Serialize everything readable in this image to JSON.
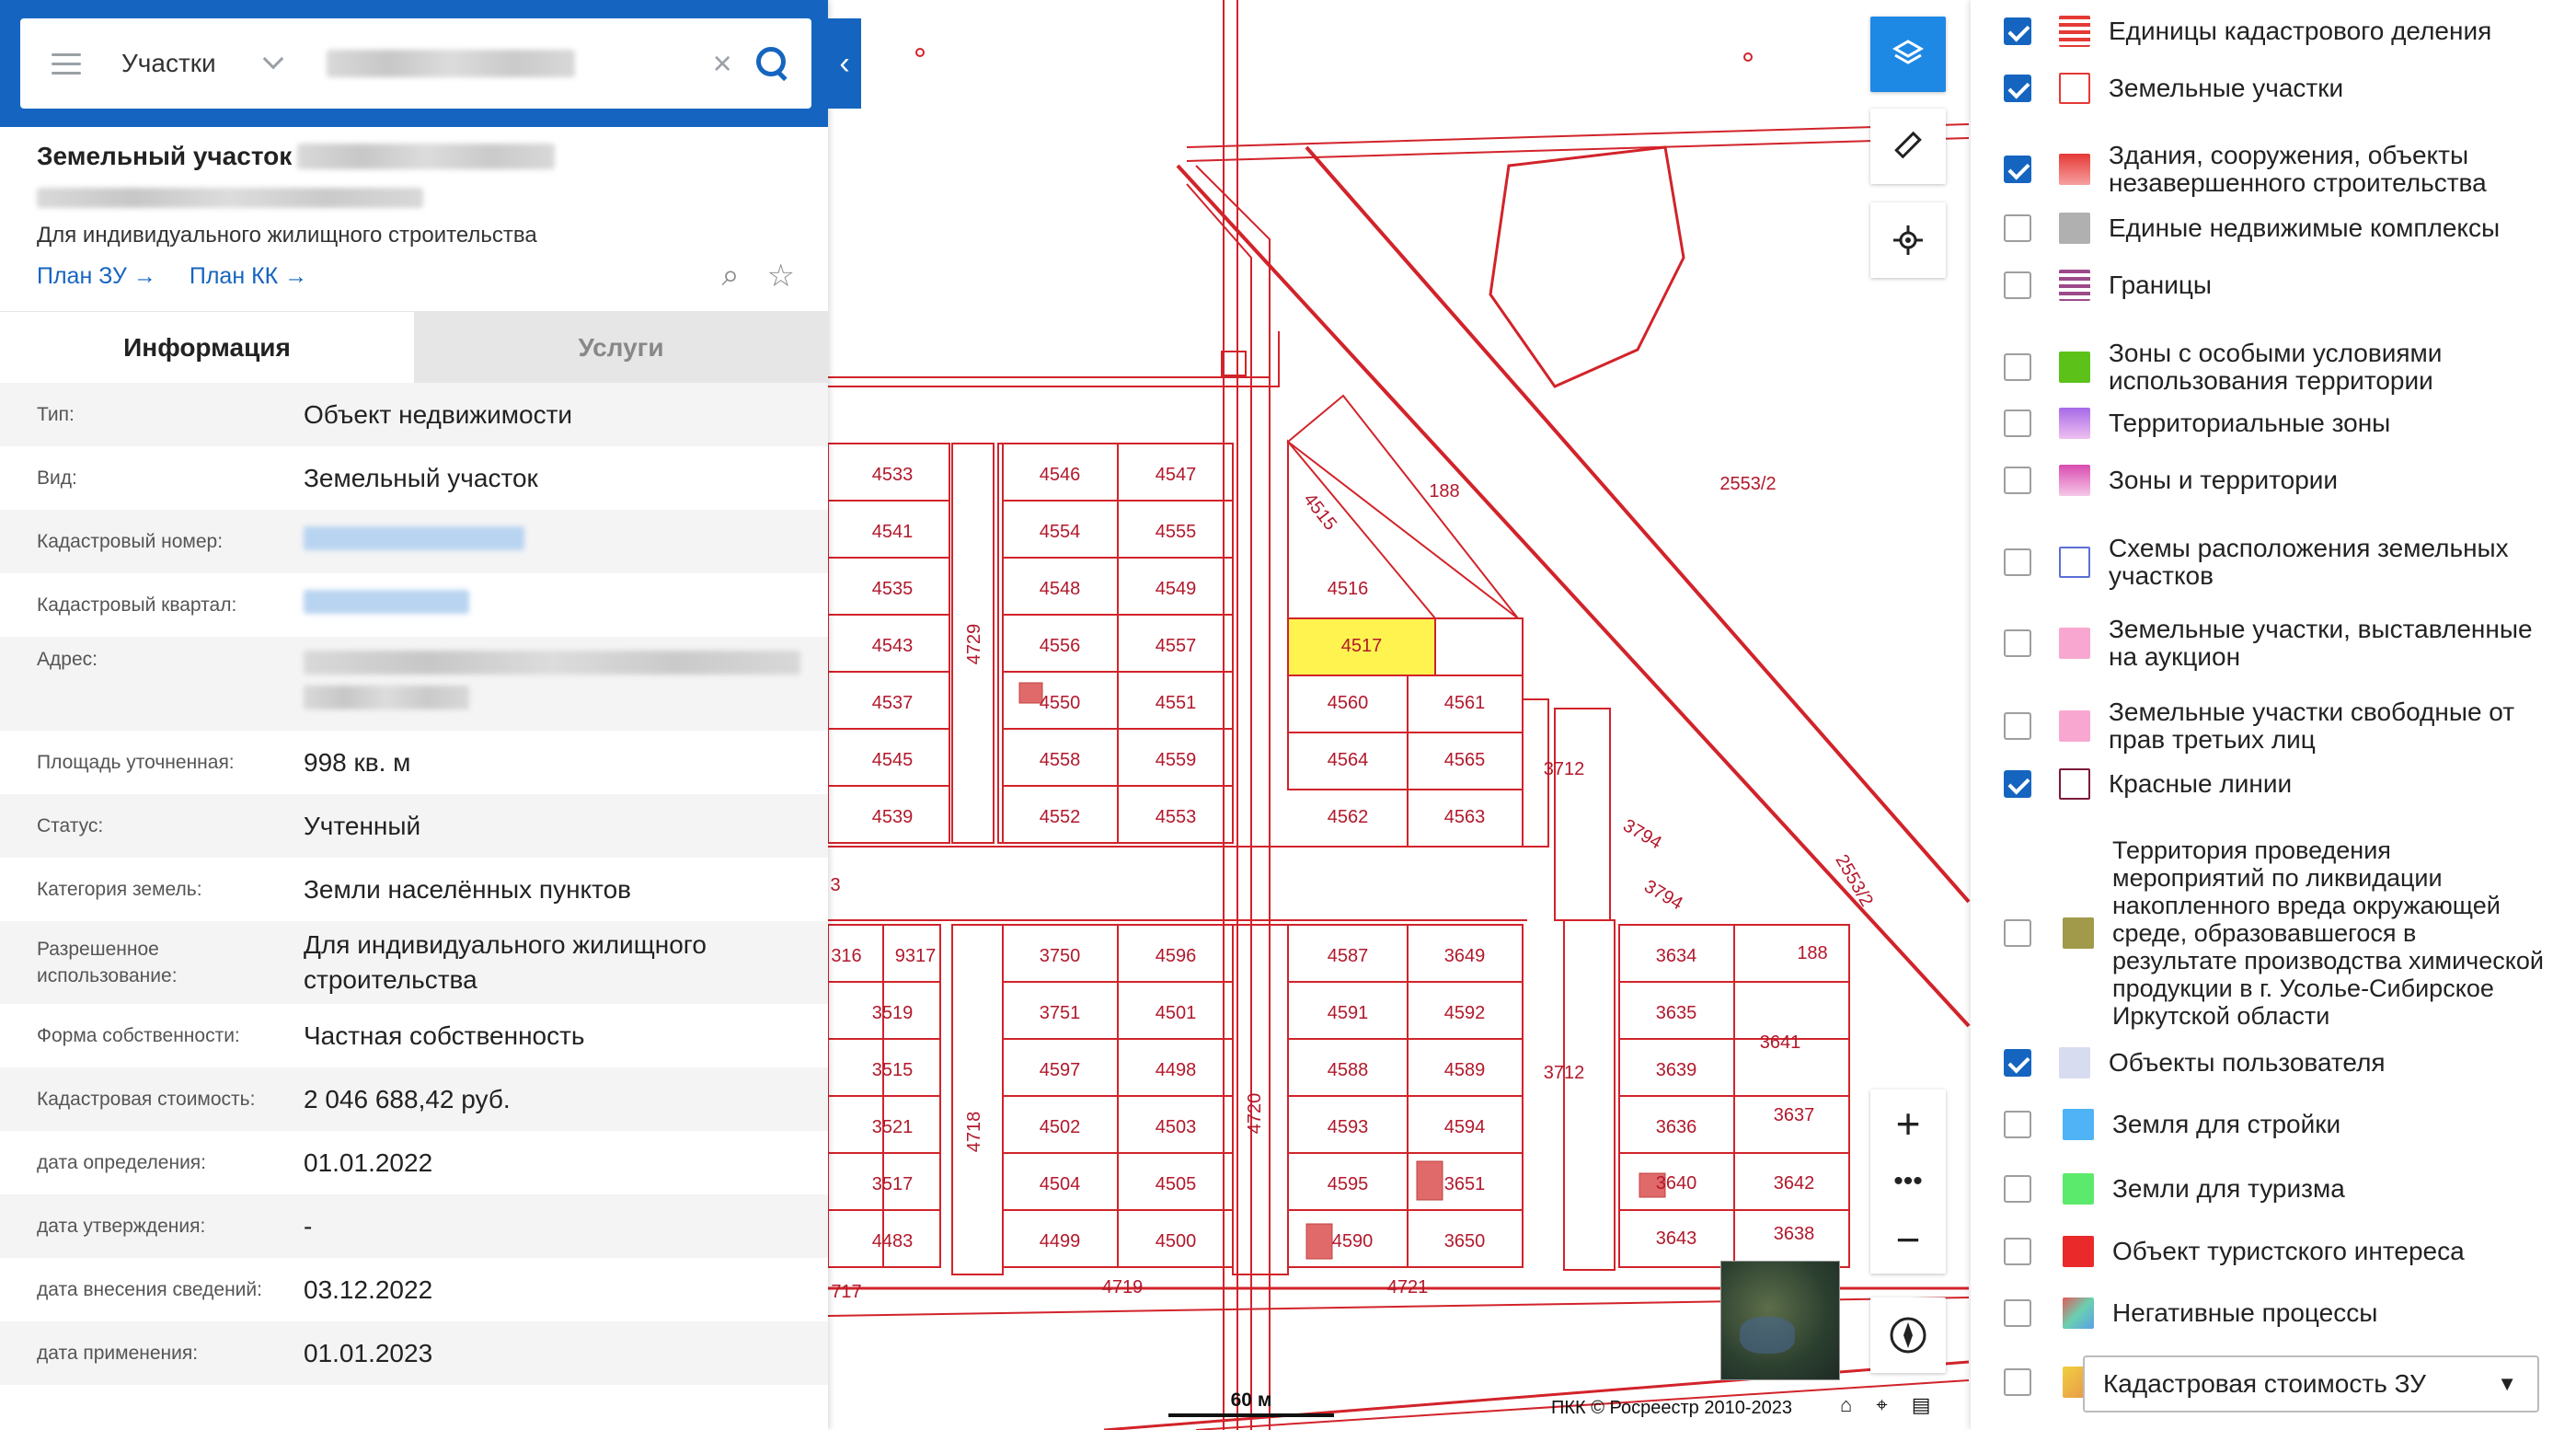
{
  "search": {
    "type_label": "Участки",
    "clear_icon": "close-icon",
    "search_icon": "search-icon"
  },
  "card": {
    "title": "Земельный участок",
    "purpose": "Для индивидуального жилищного строительства",
    "link_plan_zu": "План ЗУ →",
    "link_plan_kk": "План КК →"
  },
  "tabs": [
    {
      "label": "Информация",
      "active": true
    },
    {
      "label": "Услуги",
      "active": false
    }
  ],
  "info": {
    "type_k": "Тип:",
    "type_v": "Объект недвижимости",
    "kind_k": "Вид:",
    "kind_v": "Земельный участок",
    "cadnum_k": "Кадастровый номер:",
    "quarter_k": "Кадастровый квартал:",
    "address_k": "Адрес:",
    "area_k": "Площадь уточненная:",
    "area_v": "998 кв. м",
    "status_k": "Статус:",
    "status_v": "Учтенный",
    "category_k": "Категория земель:",
    "category_v": "Земли населённых пунктов",
    "use_k": "Разрешенное использование:",
    "use_v": "Для индивидуального жилищного строительства",
    "own_k": "Форма собственности:",
    "own_v": "Частная собственность",
    "cost_k": "Кадастровая стоимость:",
    "cost_v": "2 046 688,42 руб.",
    "def_k": "дата определения:",
    "def_v": "01.01.2022",
    "appr_k": "дата утверждения:",
    "appr_v": "-",
    "entry_k": "дата внесения сведений:",
    "entry_v": "03.12.2022",
    "apply_k": "дата применения:",
    "apply_v": "01.01.2023"
  },
  "map": {
    "scale_label": "60 м",
    "copyright": "ПКК © Росреестр 2010-2023",
    "parcel_color": "#d2232a",
    "highlight_color": "#fff44f",
    "parcels": [
      "4533",
      "4541",
      "4535",
      "4543",
      "4537",
      "4545",
      "4539",
      "4546",
      "4547",
      "4554",
      "4555",
      "4548",
      "4549",
      "4556",
      "4557",
      "4550",
      "4551",
      "4558",
      "4559",
      "4552",
      "4553",
      "4516",
      "4517",
      "4560",
      "4561",
      "4564",
      "4565",
      "4562",
      "4563",
      "4515",
      "188",
      "2553/2",
      "3712",
      "3794",
      "3794",
      "2553/2",
      "188",
      "4729",
      "316",
      "9317",
      "3750",
      "4596",
      "3519",
      "3751",
      "4501",
      "3515",
      "4597",
      "4498",
      "3521",
      "4502",
      "4503",
      "3517",
      "4504",
      "4505",
      "4483",
      "4499",
      "4500",
      "4718",
      "4720",
      "4587",
      "3649",
      "4591",
      "4592",
      "4588",
      "4589",
      "4593",
      "4594",
      "4595",
      "3651",
      "4590",
      "3650",
      "3634",
      "3635",
      "3639",
      "3641",
      "3636",
      "3637",
      "3640",
      "3642",
      "3643",
      "3638",
      "3712",
      "4719",
      "4721",
      "717",
      "3"
    ]
  },
  "layers": [
    {
      "label": "Единицы кадастрового деления",
      "checked": true,
      "swatch": "#e53935"
    },
    {
      "label": "Земельные участки",
      "checked": true,
      "swatch": "#ffffff"
    },
    {
      "label": "Здания, сооружения, объекты незавершенного строительства",
      "checked": true,
      "swatch": "#ef5350"
    },
    {
      "label": "Единые недвижимые комплексы",
      "checked": false,
      "swatch": "#b0b0b0"
    },
    {
      "label": "Границы",
      "checked": false,
      "swatch": "#9c4a8a"
    },
    {
      "label": "Зоны с особыми условиями использования территории",
      "checked": false,
      "swatch": "#5cc21a"
    },
    {
      "label": "Территориальные зоны",
      "checked": false,
      "swatch": "#c77ee0"
    },
    {
      "label": "Зоны и территории",
      "checked": false,
      "swatch": "#e07cc8"
    },
    {
      "label": "Схемы расположения земельных участков",
      "checked": false,
      "swatch": "#ffffff"
    },
    {
      "label": "Земельные участки, выставленные на аукцион",
      "checked": false,
      "swatch": "#f8a8d0"
    },
    {
      "label": "Земельные участки свободные от прав третьих лиц",
      "checked": false,
      "swatch": "#f8a8d0"
    },
    {
      "label": "Красные линии",
      "checked": true,
      "swatch": "#ffffff"
    },
    {
      "label": "Территория проведения мероприятий по ликвидации накопленного вреда окружающей среде, образовавшегося в результате производства химической продукции в г. Усолье-Сибирское Иркутской области",
      "checked": false,
      "swatch": "#a09a4a"
    },
    {
      "label": "Объекты пользователя",
      "checked": true,
      "swatch": "#d8dcf0"
    },
    {
      "label": "Земля для стройки",
      "checked": false,
      "swatch": "#4fb3f6"
    },
    {
      "label": "Земли для туризма",
      "checked": false,
      "swatch": "#5cea6c"
    },
    {
      "label": "Объект туристского интереса",
      "checked": false,
      "swatch": "#ea2a2a"
    },
    {
      "label": "Негативные процессы",
      "checked": false,
      "swatch": "#7fd0b0"
    },
    {
      "label": "Кадастровая стоимость ЗУ",
      "checked": false,
      "swatch": "#f0b060"
    }
  ]
}
